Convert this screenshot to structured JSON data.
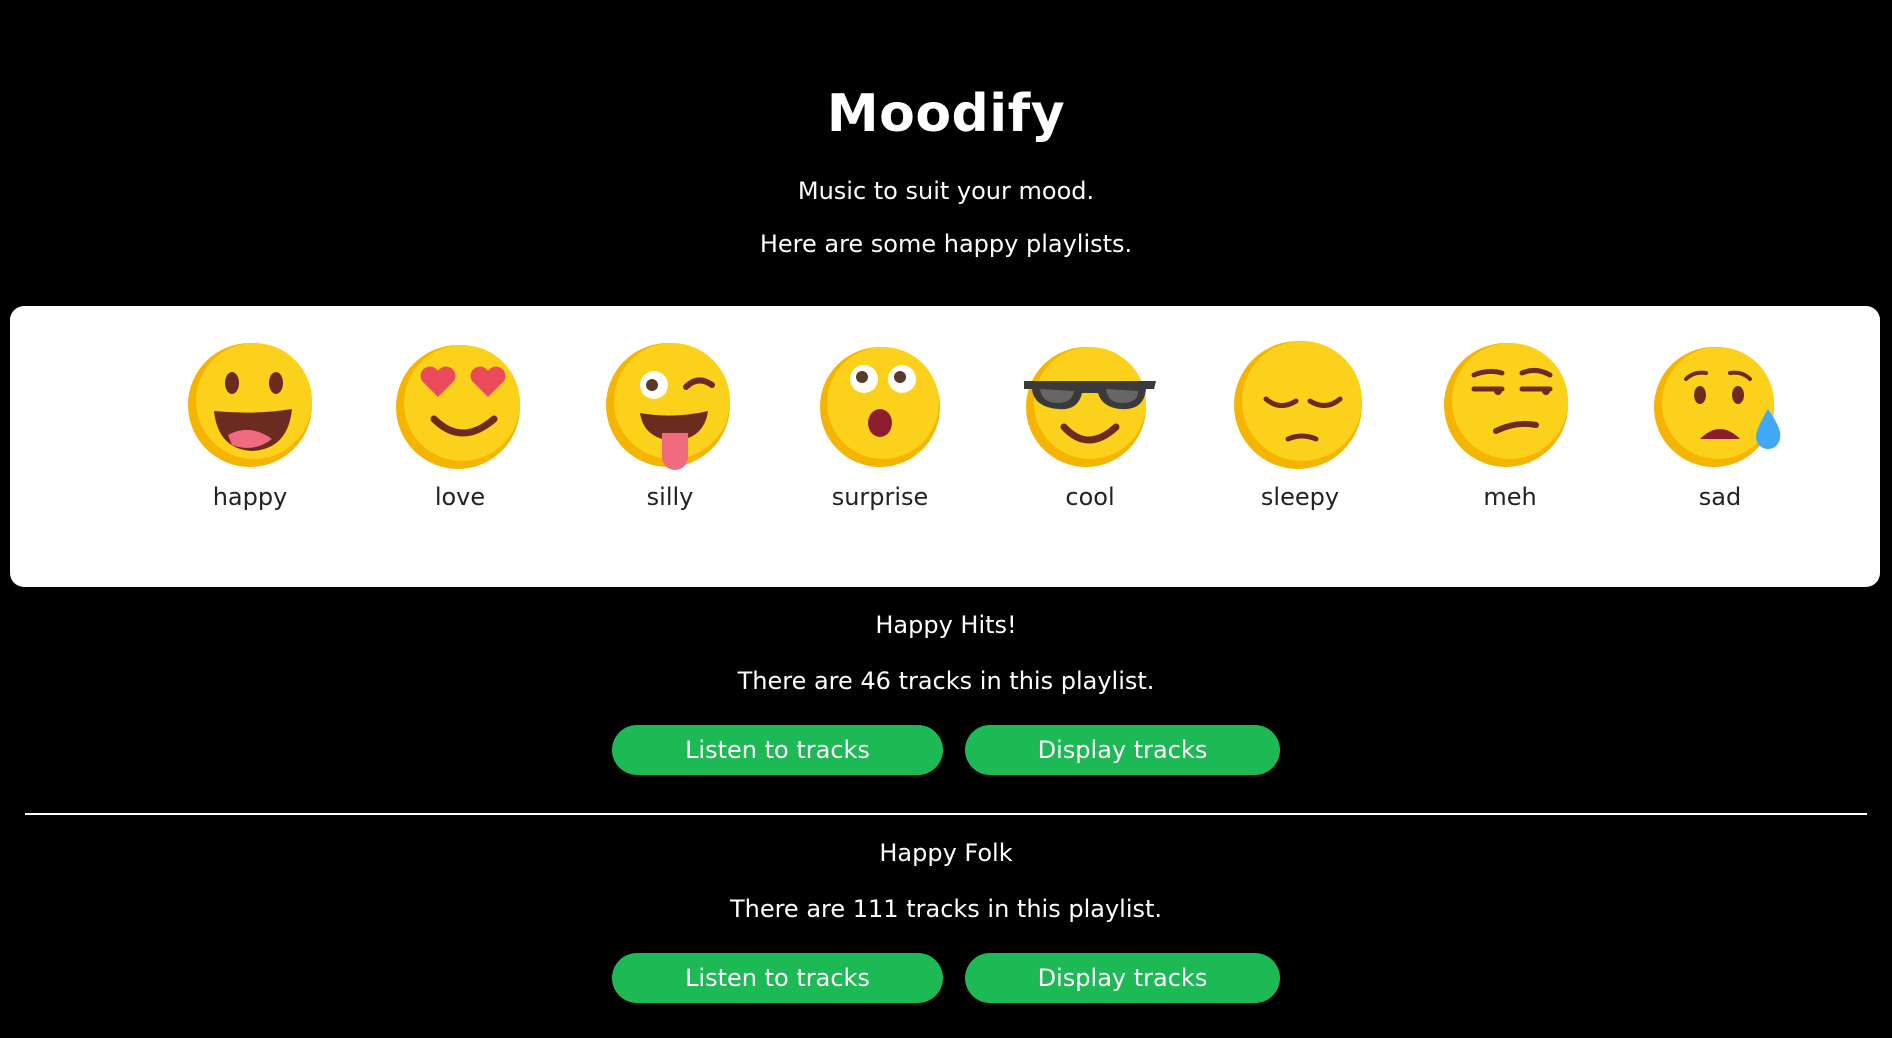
{
  "app": {
    "title": "Moodify",
    "tagline": "Music to suit your mood.",
    "intro": "Here are some happy playlists."
  },
  "moods": [
    {
      "label": "happy",
      "icon": "happy-face-icon"
    },
    {
      "label": "love",
      "icon": "heart-eyes-face-icon"
    },
    {
      "label": "silly",
      "icon": "winking-tongue-face-icon"
    },
    {
      "label": "surprise",
      "icon": "surprised-face-icon"
    },
    {
      "label": "cool",
      "icon": "sunglasses-face-icon"
    },
    {
      "label": "sleepy",
      "icon": "sleepy-face-icon"
    },
    {
      "label": "meh",
      "icon": "unamused-face-icon"
    },
    {
      "label": "sad",
      "icon": "sad-sweat-face-icon"
    }
  ],
  "playlists": [
    {
      "name": "Happy Hits!",
      "count_text": "There are 46 tracks in this playlist.",
      "listen_label": "Listen to tracks",
      "display_label": "Display tracks"
    },
    {
      "name": "Happy Folk",
      "count_text": "There are 111 tracks in this playlist.",
      "listen_label": "Listen to tracks",
      "display_label": "Display tracks"
    }
  ],
  "colors": {
    "background": "#000000",
    "panel": "#ffffff",
    "button": "#1db954",
    "emoji_yellow": "#fcd11b"
  }
}
